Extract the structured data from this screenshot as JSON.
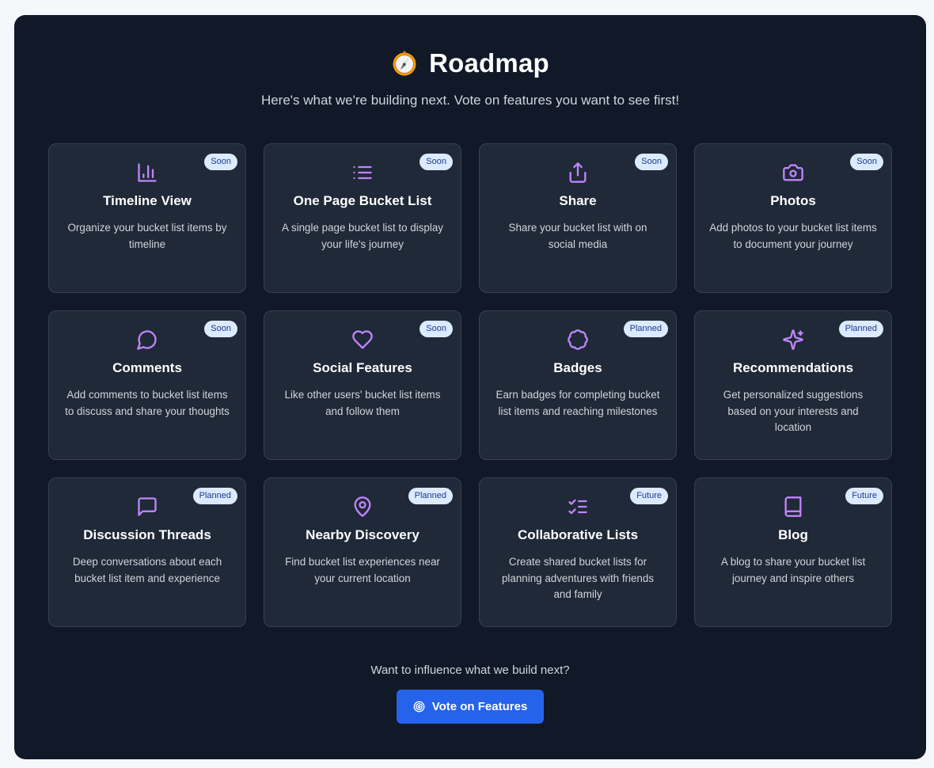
{
  "header": {
    "icon": "compass-icon",
    "title": "Roadmap",
    "subtitle": "Here's what we're building next. Vote on features you want to see first!"
  },
  "colors": {
    "panel_bg": "#111827",
    "card_bg": "#1f2937",
    "icon_accent": "#c084fc",
    "badge_bg": "#dbeafe",
    "badge_text": "#1e3a8a",
    "button_bg": "#2563eb"
  },
  "features": [
    {
      "icon": "chart-icon",
      "badge": "Soon",
      "title": "Timeline View",
      "description": "Organize your bucket list items by timeline"
    },
    {
      "icon": "list-icon",
      "badge": "Soon",
      "title": "One Page Bucket List",
      "description": "A single page bucket list to display your life's journey"
    },
    {
      "icon": "share-icon",
      "badge": "Soon",
      "title": "Share",
      "description": "Share your bucket list with on social media"
    },
    {
      "icon": "camera-icon",
      "badge": "Soon",
      "title": "Photos",
      "description": "Add photos to your bucket list items to document your journey"
    },
    {
      "icon": "message-circle-icon",
      "badge": "Soon",
      "title": "Comments",
      "description": "Add comments to bucket list items to discuss and share your thoughts"
    },
    {
      "icon": "heart-icon",
      "badge": "Soon",
      "title": "Social Features",
      "description": "Like other users' bucket list items and follow them"
    },
    {
      "icon": "badge-icon",
      "badge": "Planned",
      "title": "Badges",
      "description": "Earn badges for completing bucket list items and reaching milestones"
    },
    {
      "icon": "sparkles-icon",
      "badge": "Planned",
      "title": "Recommendations",
      "description": "Get personalized suggestions based on your interests and location"
    },
    {
      "icon": "message-square-icon",
      "badge": "Planned",
      "title": "Discussion Threads",
      "description": "Deep conversations about each bucket list item and experience"
    },
    {
      "icon": "map-pin-icon",
      "badge": "Planned",
      "title": "Nearby Discovery",
      "description": "Find bucket list experiences near your current location"
    },
    {
      "icon": "list-checks-icon",
      "badge": "Future",
      "title": "Collaborative Lists",
      "description": "Create shared bucket lists for planning adventures with friends and family"
    },
    {
      "icon": "book-icon",
      "badge": "Future",
      "title": "Blog",
      "description": "A blog to share your bucket list journey and inspire others"
    }
  ],
  "footer": {
    "prompt": "Want to influence what we build next?",
    "button_icon": "target-icon",
    "button_label": "Vote on Features"
  }
}
